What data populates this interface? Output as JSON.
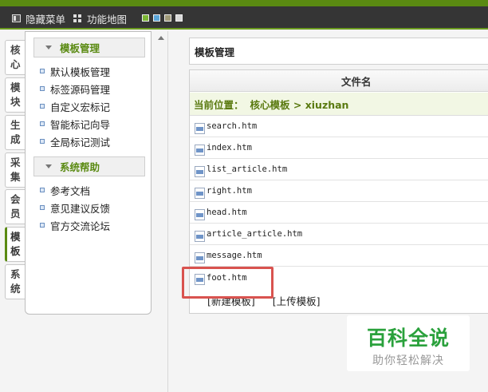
{
  "topbar": {
    "hide_menu": "隐藏菜单",
    "function_map": "功能地图",
    "theme_swatches": [
      "#7bb534",
      "#5aa5d8",
      "#a09a78",
      "#d9d9d9"
    ]
  },
  "left_tabs": [
    "核心",
    "模块",
    "生成",
    "采集",
    "会员",
    "模板",
    "系统"
  ],
  "menu": {
    "groups": [
      {
        "title": "模板管理",
        "items": [
          "默认模板管理",
          "标签源码管理",
          "自定义宏标记",
          "智能标记向导",
          "全局标记测试"
        ]
      },
      {
        "title": "系统帮助",
        "items": [
          "参考文档",
          "意见建议反馈",
          "官方交流论坛"
        ]
      }
    ]
  },
  "main": {
    "title": "模板管理",
    "column_header": "文件名",
    "breadcrumb_prefix": "当前位置：",
    "breadcrumb_path": "核心模板 > xiuzhan",
    "files": [
      "search.htm",
      "index.htm",
      "list_article.htm",
      "right.htm",
      "head.htm",
      "article_article.htm",
      "message.htm",
      "foot.htm"
    ],
    "new_template": "[新建模板]",
    "upload_template": "[上传模板]"
  },
  "watermark": {
    "title": "百科全说",
    "subtitle": "助你轻松解决"
  },
  "colors": {
    "accent": "#5a8a12",
    "topbar": "#353535",
    "highlight": "#d9534f",
    "watermark": "#2aa13c"
  }
}
